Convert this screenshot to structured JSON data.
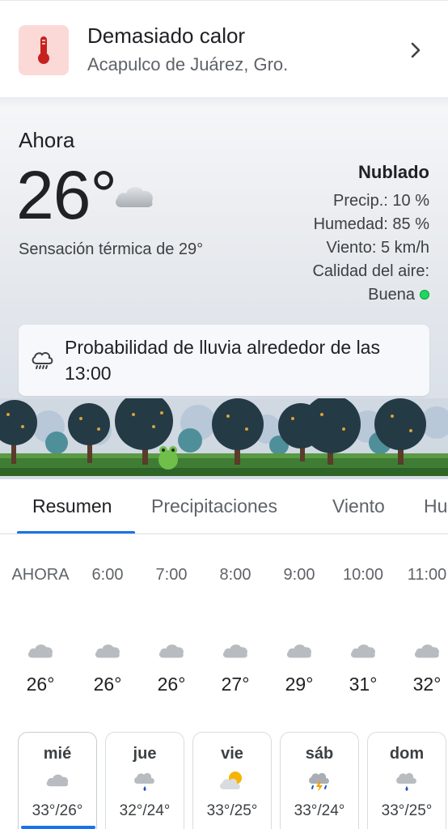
{
  "alert": {
    "title": "Demasiado calor",
    "location": "Acapulco de Juárez, Gro."
  },
  "current": {
    "label": "Ahora",
    "temp": "26°",
    "feels_like": "Sensación térmica de 29°",
    "condition": "Nublado",
    "precip": "Precip.: 10 %",
    "humidity": "Humedad: 85 %",
    "wind": "Viento: 5 km/h",
    "air_quality_label": "Calidad del aire:",
    "air_quality_value": "Buena",
    "rain_notice": "Probabilidad de lluvia alrededor de las 13:00"
  },
  "tabs": [
    {
      "label": "Resumen"
    },
    {
      "label": "Precipitaciones"
    },
    {
      "label": "Viento"
    },
    {
      "label": "Hu"
    }
  ],
  "hourly": [
    {
      "time": "AHORA",
      "temp": "26°",
      "icon": "cloud-icon"
    },
    {
      "time": "6:00",
      "temp": "26°",
      "icon": "cloud-icon"
    },
    {
      "time": "7:00",
      "temp": "26°",
      "icon": "cloud-icon"
    },
    {
      "time": "8:00",
      "temp": "27°",
      "icon": "cloud-icon"
    },
    {
      "time": "9:00",
      "temp": "29°",
      "icon": "cloud-icon"
    },
    {
      "time": "10:00",
      "temp": "31°",
      "icon": "cloud-icon"
    },
    {
      "time": "11:00",
      "temp": "32°",
      "icon": "cloud-icon"
    }
  ],
  "daily": [
    {
      "day": "mié",
      "temps": "33°/26°",
      "icon": "cloud-icon"
    },
    {
      "day": "jue",
      "temps": "32°/24°",
      "icon": "rain-cloud-icon"
    },
    {
      "day": "vie",
      "temps": "33°/25°",
      "icon": "partly-sunny-icon"
    },
    {
      "day": "sáb",
      "temps": "33°/24°",
      "icon": "thunderstorm-icon"
    },
    {
      "day": "dom",
      "temps": "33°/25°",
      "icon": "rain-cloud-icon"
    }
  ],
  "colors": {
    "accent": "#1a73e8",
    "alert_bg": "#fbd9d6",
    "alert_icon": "#c5221f",
    "aqi_good": "#1ed760"
  }
}
